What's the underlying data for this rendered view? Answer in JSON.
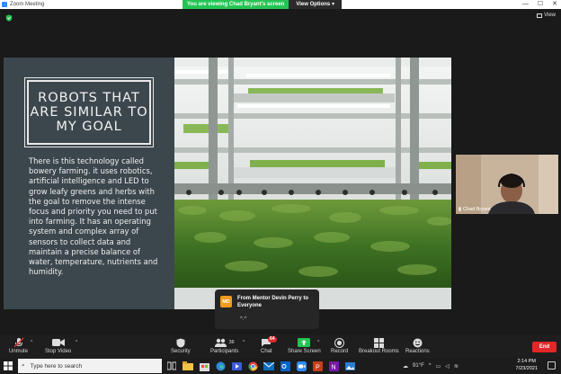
{
  "window": {
    "title": "Zoom Meeting"
  },
  "banner": {
    "viewing": "You are viewing Chad Bryant's screen",
    "view_options": "View Options"
  },
  "view_button": {
    "label": "View"
  },
  "slide": {
    "title": "ROBOTS THAT ARE SIMILAR TO MY GOAL",
    "body": "There is this technology called bowery farming. it uses robotics, artificial intelligence and LED to grow leafy greens and herbs with the goal to remove the intense focus and priority you need to put into farming. It has an operating system and complex array of sensors to collect data and maintain a precise balance of water, temperature, nutrients and humidity."
  },
  "participant_video": {
    "name": "Chad Bryant"
  },
  "chat_popup": {
    "avatar_initials": "MD",
    "from": "From Mentor Devin Perry to Everyone",
    "message": "^.^"
  },
  "toolbar": {
    "unmute": "Unmute",
    "stop_video": "Stop Video",
    "security": "Security",
    "participants": "Participants",
    "participants_count": "36",
    "chat": "Chat",
    "chat_badge": "64",
    "share_screen": "Share Screen",
    "record": "Record",
    "breakout_rooms": "Breakout Rooms",
    "reactions": "Reactions",
    "end": "End"
  },
  "taskbar": {
    "search_placeholder": "Type here to search",
    "temperature": "91°F",
    "time": "2:14 PM",
    "date": "7/23/2021"
  },
  "colors": {
    "accent_green": "#23c552",
    "end_red": "#e02828",
    "zoom_blue": "#2d8cff",
    "slide_bg": "#3c474d"
  }
}
